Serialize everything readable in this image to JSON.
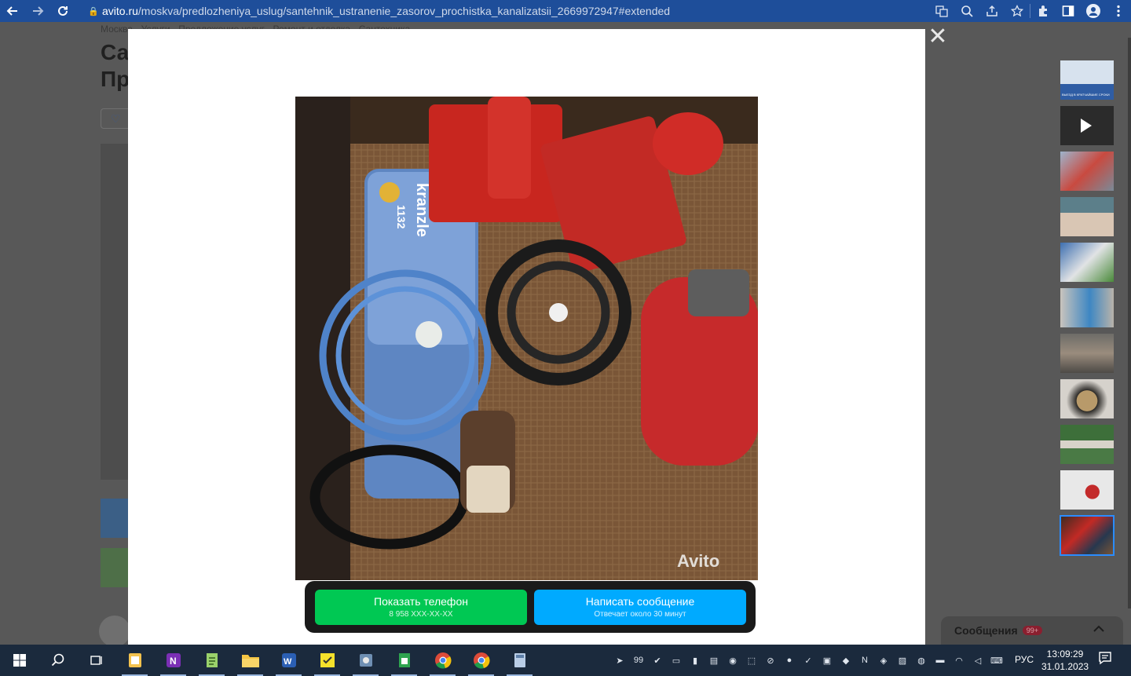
{
  "browser": {
    "url_host": "avito.ru",
    "url_path": "/moskva/predlozheniya_uslug/santehnik_ustranenie_zasorov_prochistka_kanalizatsii_2669972947#extended"
  },
  "page": {
    "breadcrumb": "Москва · Услуги · Предложение услуг · Ремонт и отделка · Сантехника",
    "title_line1": "Са",
    "title_line2": "Пр",
    "fav_label": "♡ "
  },
  "modal": {
    "watermark": "Avito",
    "phone_button": {
      "label": "Показать телефон",
      "sub": "8 958 XXX-XX-XX"
    },
    "message_button": {
      "label": "Написать сообщение",
      "sub": "Отвечает около 30 минут"
    },
    "photo_brand": "kranzle",
    "photo_model": "1132"
  },
  "thumbnails": {
    "count": 11,
    "selected_index": 10,
    "first_caption": "ВЫЕЗД В КРАТЧАЙШИЕ СРОКИ"
  },
  "messages_widget": {
    "label": "Сообщения",
    "badge": "99+"
  },
  "taskbar": {
    "tray_badge": "99",
    "language": "РУС",
    "time": "13:09:29",
    "date": "31.01.2023"
  }
}
